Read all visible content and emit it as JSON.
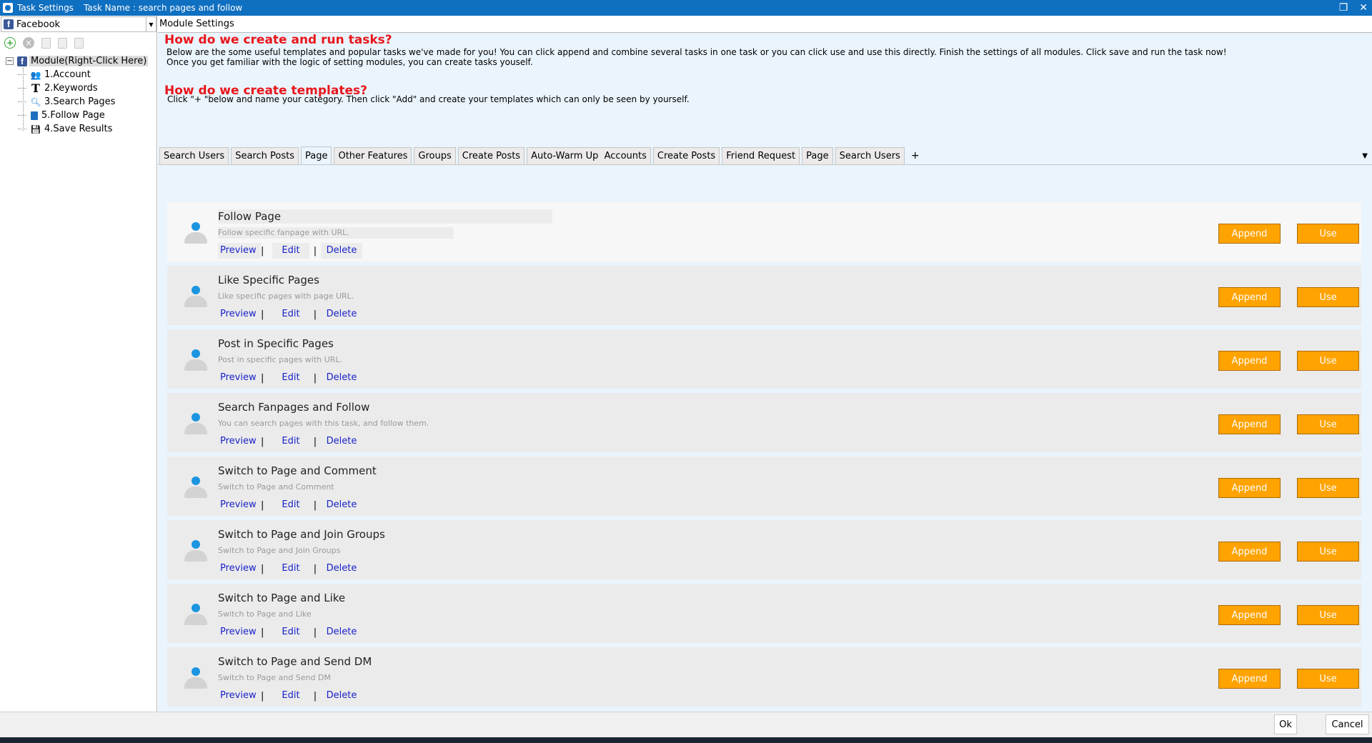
{
  "window": {
    "title": "Task Settings",
    "task_name": "Task Name : search pages and follow",
    "restore_symbol": "❐",
    "close_symbol": "✕"
  },
  "left_panel": {
    "platform": "Facebook",
    "platform_icon": "f",
    "tree": {
      "root": "Module(Right-Click Here)",
      "children": [
        {
          "label": "1.Account",
          "icon": "people-icon"
        },
        {
          "label": "2.Keywords",
          "icon": "text-t-icon"
        },
        {
          "label": "3.Search Pages",
          "icon": "magnifier-icon"
        },
        {
          "label": "5.Follow Page",
          "icon": "book-icon"
        },
        {
          "label": "4.Save Results",
          "icon": "floppy-disk-icon"
        }
      ]
    }
  },
  "right_panel": {
    "header": "Module Settings",
    "info": {
      "heading1": "How do we create and run tasks?",
      "para1_line1": "Below are the some useful templates and popular tasks we've made for you!  You can click append and combine several tasks in one task or you can click use and use this directly. Finish the settings of all modules. Click save and run the task now!",
      "para1_line2": "Once you get familiar with the logic of setting modules, you can create tasks youself.",
      "heading2": "How do we create templates?",
      "para2": "Click \"+ \"below and name your category. Then click \"Add\" and create your templates which can only be seen by yourself."
    },
    "tabs": [
      "Search Users",
      "Search Posts",
      "Page",
      "Other Features",
      "Groups",
      "Create Posts",
      "Auto-Warm Up  Accounts",
      "Create Posts",
      "Friend Request",
      "Page",
      "Search Users"
    ],
    "active_tab": "Page",
    "add_tab": "+",
    "tab_menu": "▼",
    "templates": [
      {
        "title": "Follow Page",
        "desc": "Follow specific fanpage with URL."
      },
      {
        "title": "Like Specific Pages",
        "desc": "Like specific pages with page URL."
      },
      {
        "title": "Post in Specific Pages",
        "desc": "Post in specific pages with URL."
      },
      {
        "title": "Search Fanpages and Follow",
        "desc": "You can search pages with this task, and follow them."
      },
      {
        "title": "Switch to Page and Comment",
        "desc": "Switch to Page and Comment"
      },
      {
        "title": "Switch to Page and Join Groups",
        "desc": "Switch to Page and Join Groups"
      },
      {
        "title": "Switch to Page and Like",
        "desc": "Switch to Page and Like"
      },
      {
        "title": "Switch to Page and Send DM",
        "desc": "Switch to Page and Send DM"
      }
    ],
    "labels": {
      "preview": "Preview",
      "edit": "Edit",
      "delete": "Delete",
      "separator": "|",
      "append": "Append",
      "use": "Use"
    }
  },
  "footer": {
    "ok": "Ok",
    "cancel": "Cancel"
  },
  "colors": {
    "title_bar": "#0f6fc0",
    "heading_red": "#e8161b",
    "link_blue": "#1a22c8",
    "button_orange": "#ffa300",
    "info_bg": "#eaf4fc"
  }
}
